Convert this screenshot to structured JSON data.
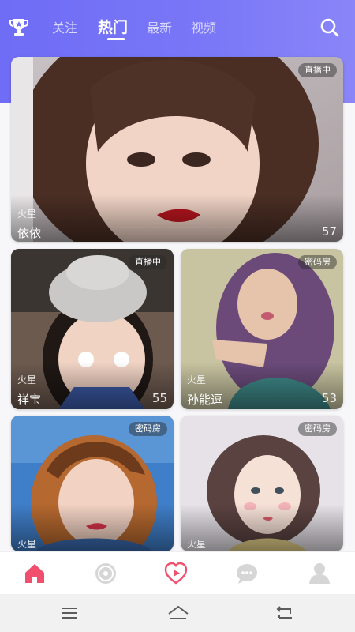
{
  "header": {
    "tabs": [
      {
        "label": "关注",
        "active": false
      },
      {
        "label": "热门",
        "active": true
      },
      {
        "label": "最新",
        "active": false
      },
      {
        "label": "视频",
        "active": false
      }
    ],
    "trophy_icon": "trophy-icon",
    "search_icon": "search-icon",
    "accent_color": "#7472f6"
  },
  "cards": [
    {
      "badge": "直播中",
      "location": "火星",
      "name": "依依",
      "count": "57"
    },
    {
      "badge": "直播中",
      "location": "火星",
      "name": "祥宝",
      "count": "55"
    },
    {
      "badge": "密码房",
      "location": "火星",
      "name": "孙能逗",
      "count": "53"
    },
    {
      "badge": "密码房",
      "location": "火星",
      "name": "",
      "count": ""
    },
    {
      "badge": "密码房",
      "location": "火星",
      "name": "",
      "count": ""
    }
  ],
  "bottom_nav": [
    {
      "icon": "home-icon",
      "active": true
    },
    {
      "icon": "disc-icon",
      "active": false
    },
    {
      "icon": "heart-play-icon",
      "active": false
    },
    {
      "icon": "chat-icon",
      "active": false
    },
    {
      "icon": "profile-icon",
      "active": false
    }
  ],
  "system_bar": [
    "menu-icon",
    "home-system-icon",
    "back-icon"
  ]
}
